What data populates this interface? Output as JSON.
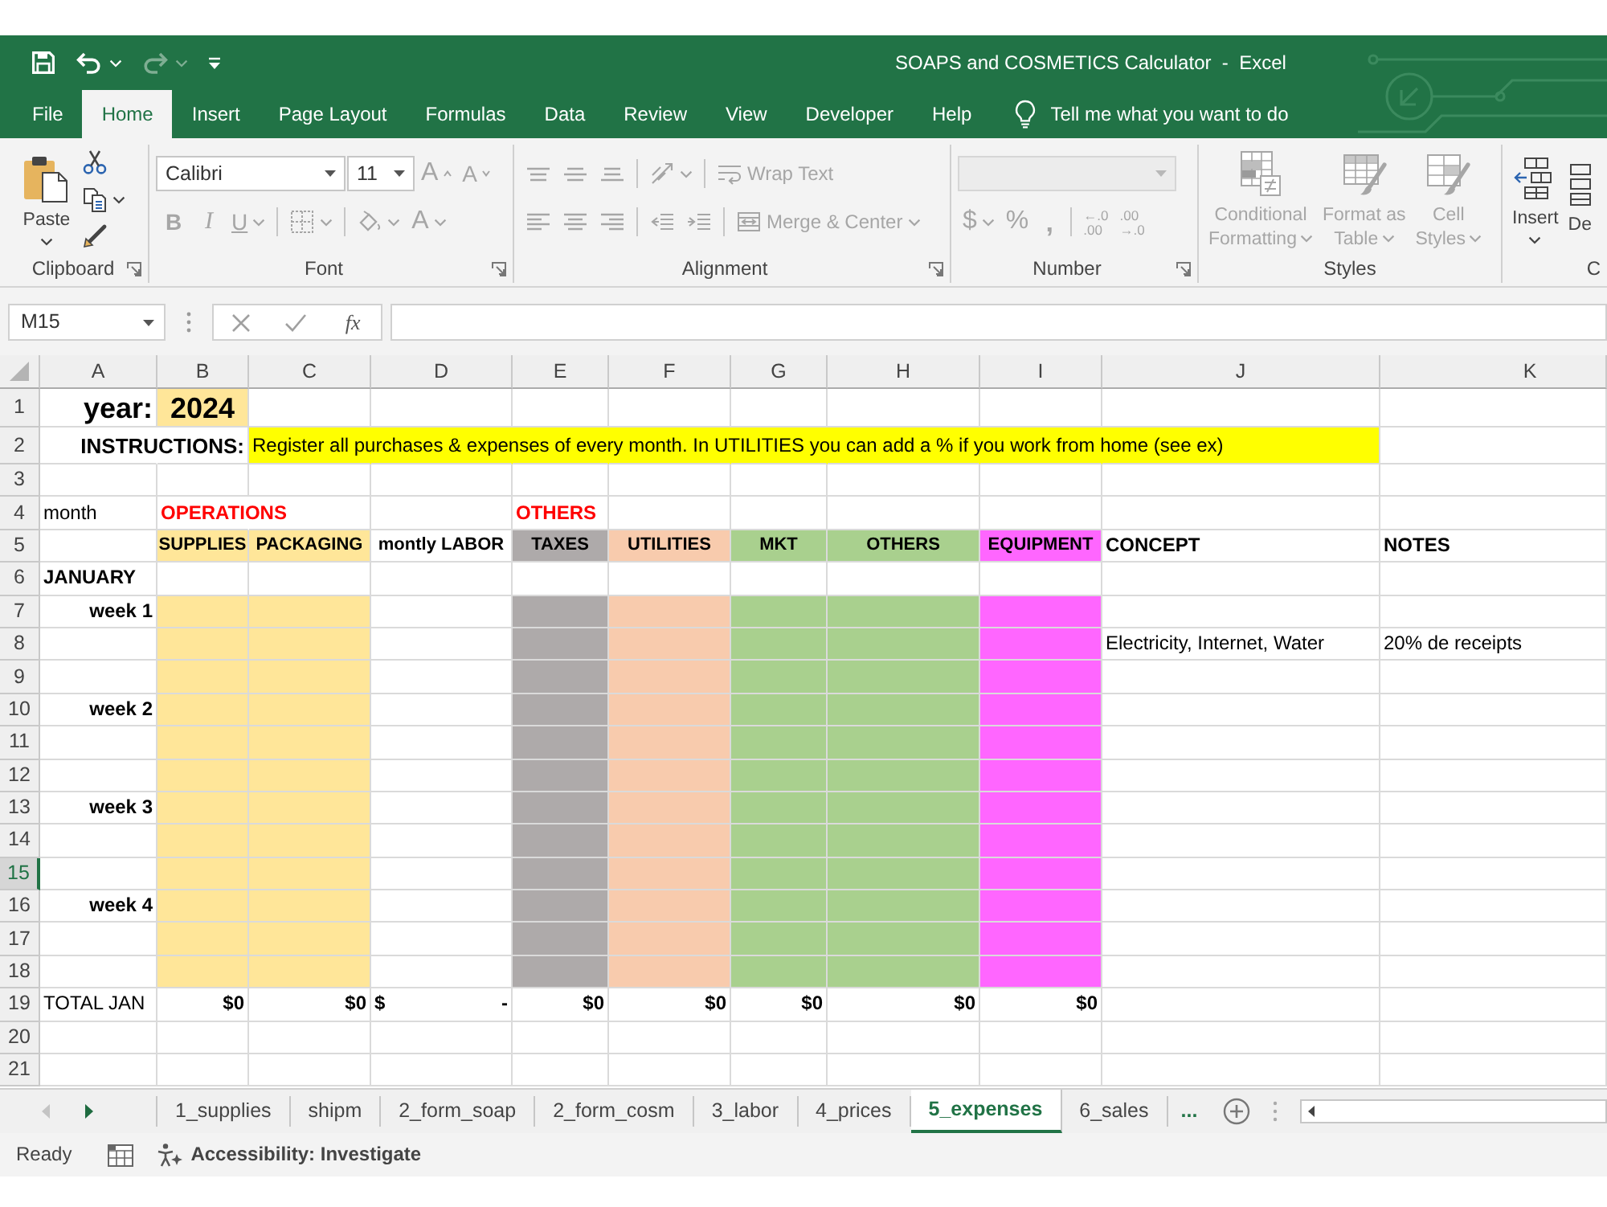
{
  "title_bar": {
    "quick_access": [
      {
        "disabled": false
      },
      {
        "disabled": false
      },
      {
        "disabled": true
      },
      {
        "disabled": false
      }
    ],
    "title": "SOAPS and COSMETICS Calculator  -  Excel"
  },
  "tabs": [
    {
      "label": "File",
      "selected": false
    },
    {
      "label": "Home",
      "selected": true
    },
    {
      "label": "Insert",
      "selected": false
    },
    {
      "label": "Page Layout",
      "selected": false
    },
    {
      "label": "Formulas",
      "selected": false
    },
    {
      "label": "Data",
      "selected": false
    },
    {
      "label": "Review",
      "selected": false
    },
    {
      "label": "View",
      "selected": false
    },
    {
      "label": "Developer",
      "selected": false
    },
    {
      "label": "Help",
      "selected": false
    }
  ],
  "tell_me": {
    "placeholder": "Tell me what you want to do"
  },
  "ribbon": {
    "groups": [
      {
        "label": "Clipboard",
        "launcher": true,
        "items": [
          {
            "kind": "large",
            "lines": [
              "Paste"
            ],
            "disabled": false
          },
          {
            "kind": "icon",
            "disabled": false
          },
          {
            "kind": "icon",
            "disabled": false
          },
          {
            "kind": "icon",
            "disabled": false
          }
        ]
      },
      {
        "label": "Font",
        "launcher": true,
        "items": [
          {
            "kind": "combo",
            "value": "Calibri",
            "disabled": false
          },
          {
            "kind": "combo",
            "value": "11",
            "disabled": false
          },
          {
            "kind": "glyph",
            "label": "A",
            "disabled": true
          },
          {
            "kind": "glyph",
            "label": "A",
            "disabled": true
          },
          {
            "kind": "glyph",
            "label": "B",
            "disabled": true
          },
          {
            "kind": "glyph",
            "label": "I",
            "disabled": true
          },
          {
            "kind": "glyph",
            "label": "U",
            "disabled": true
          },
          {
            "kind": "icon",
            "disabled": true
          },
          {
            "kind": "icon",
            "disabled": true
          },
          {
            "kind": "glyph",
            "label": "A",
            "disabled": true
          }
        ]
      },
      {
        "label": "Alignment",
        "launcher": true,
        "items": [
          {
            "kind": "icon",
            "disabled": true
          },
          {
            "kind": "icon",
            "disabled": true
          },
          {
            "kind": "icon",
            "disabled": true
          },
          {
            "kind": "icon",
            "disabled": true
          },
          {
            "kind": "text",
            "label": "Wrap Text",
            "disabled": true
          },
          {
            "kind": "icon",
            "disabled": true
          },
          {
            "kind": "icon",
            "disabled": true
          },
          {
            "kind": "icon",
            "disabled": true
          },
          {
            "kind": "icon",
            "disabled": true
          },
          {
            "kind": "icon",
            "disabled": true
          },
          {
            "kind": "text",
            "label": "Merge & Center",
            "disabled": true
          }
        ]
      },
      {
        "label": "Number",
        "launcher": true,
        "items": [
          {
            "kind": "combo",
            "disabled": true
          },
          {
            "kind": "glyph",
            "label": "$",
            "disabled": true
          },
          {
            "kind": "glyph",
            "label": "%",
            "disabled": true
          },
          {
            "kind": "glyph",
            "label": ",",
            "disabled": true
          },
          {
            "kind": "stack",
            "lines": [
              "←.0",
              ".00"
            ],
            "disabled": true
          },
          {
            "kind": "stack",
            "lines": [
              ".00",
              "→.0"
            ],
            "disabled": true
          }
        ]
      },
      {
        "label": "Styles",
        "launcher": false,
        "items": [
          {
            "kind": "large",
            "lines": [
              "Conditional",
              "Formatting"
            ],
            "disabled": true
          },
          {
            "kind": "large",
            "lines": [
              "Format as",
              "Table"
            ],
            "disabled": true
          },
          {
            "kind": "large",
            "lines": [
              "Cell",
              "Styles"
            ],
            "disabled": true
          }
        ]
      },
      {
        "label": "C",
        "launcher": false,
        "items": [
          {
            "kind": "large",
            "lines": [
              "Insert"
            ],
            "disabled": false
          },
          {
            "kind": "large",
            "lines": [
              "De"
            ],
            "disabled": false
          }
        ]
      }
    ]
  },
  "formula_bar": {
    "name_box": "M15",
    "function_button": "fx"
  },
  "sheet": {
    "columns": [
      {
        "letter": "A",
        "selected": false
      },
      {
        "letter": "B",
        "selected": false
      },
      {
        "letter": "C",
        "selected": false
      },
      {
        "letter": "D",
        "selected": false
      },
      {
        "letter": "E",
        "selected": false
      },
      {
        "letter": "F",
        "selected": false
      },
      {
        "letter": "G",
        "selected": false
      },
      {
        "letter": "H",
        "selected": false
      },
      {
        "letter": "I",
        "selected": false
      },
      {
        "letter": "J",
        "selected": false
      },
      {
        "letter": "K",
        "selected": false
      }
    ],
    "rows": [
      {
        "number": "1",
        "selected": false,
        "cells": [
          {
            "text": "year:",
            "kind": "prompt"
          },
          {
            "text": "2024",
            "kind": "year",
            "color": "#ffe699"
          }
        ]
      },
      {
        "number": "2",
        "selected": false,
        "cells": [
          null,
          {
            "text": "INSTRUCTIONS:",
            "kind": "caption"
          },
          {
            "text": "Register all purchases & expenses of every month. In UTILITIES you can add a % if you work from home (see ex)",
            "kind": "note",
            "color": "#ffff00"
          },
          {
            "color": "#ffff00"
          },
          {
            "color": "#ffff00"
          },
          {
            "color": "#ffff00"
          },
          {
            "color": "#ffff00"
          },
          {
            "color": "#ffff00"
          },
          {
            "color": "#ffff00"
          },
          {
            "color": "#ffff00"
          }
        ]
      },
      {
        "number": "3",
        "selected": false
      },
      {
        "number": "4",
        "selected": false,
        "cells": [
          {
            "text": "month",
            "kind": "note"
          },
          {
            "text": "OPERATIONS",
            "kind": "group"
          },
          null,
          null,
          {
            "text": "OTHERS",
            "kind": "group"
          }
        ]
      },
      {
        "number": "5",
        "selected": false,
        "cells": [
          null,
          {
            "text": "SUPPLIES",
            "kind": "head",
            "color": "#ffe699"
          },
          {
            "text": "PACKAGING",
            "kind": "head",
            "color": "#ffe699"
          },
          {
            "text": "montly LABOR",
            "kind": "head"
          },
          {
            "text": "TAXES",
            "kind": "head",
            "color": "#aeaaaa"
          },
          {
            "text": "UTILITIES",
            "kind": "head",
            "color": "#f8cbad"
          },
          {
            "text": "MKT",
            "kind": "head",
            "color": "#a9d08e"
          },
          {
            "text": "OTHERS",
            "kind": "head",
            "color": "#a9d08e"
          },
          {
            "text": "EQUIPMENT",
            "kind": "head",
            "color": "#ff66ff"
          },
          {
            "text": "CONCEPT",
            "kind": "title"
          },
          {
            "text": "NOTES",
            "kind": "title"
          }
        ]
      },
      {
        "number": "6",
        "selected": false,
        "cells": [
          {
            "text": "JANUARY",
            "kind": "month"
          }
        ]
      },
      {
        "number": "7",
        "selected": false,
        "cells": [
          {
            "text": "week 1",
            "kind": "label"
          },
          {
            "color": "#ffe699"
          },
          {
            "color": "#ffe699"
          },
          null,
          {
            "color": "#aeaaaa"
          },
          {
            "color": "#f8cbad"
          },
          {
            "color": "#a9d08e"
          },
          {
            "color": "#a9d08e"
          },
          {
            "color": "#ff66ff"
          }
        ]
      },
      {
        "number": "8",
        "selected": false,
        "cells": [
          null,
          {
            "color": "#ffe699"
          },
          {
            "color": "#ffe699"
          },
          null,
          {
            "color": "#aeaaaa"
          },
          {
            "color": "#f8cbad"
          },
          {
            "color": "#a9d08e"
          },
          {
            "color": "#a9d08e"
          },
          {
            "color": "#ff66ff"
          },
          {
            "text": "Electricity, Internet, Water",
            "kind": "note"
          },
          {
            "text": "20% de receipts",
            "kind": "note"
          }
        ]
      },
      {
        "number": "9",
        "selected": false,
        "cells": [
          null,
          {
            "color": "#ffe699"
          },
          {
            "color": "#ffe699"
          },
          null,
          {
            "color": "#aeaaaa"
          },
          {
            "color": "#f8cbad"
          },
          {
            "color": "#a9d08e"
          },
          {
            "color": "#a9d08e"
          },
          {
            "color": "#ff66ff"
          }
        ]
      },
      {
        "number": "10",
        "selected": false,
        "cells": [
          {
            "text": "week 2",
            "kind": "label"
          },
          {
            "color": "#ffe699"
          },
          {
            "color": "#ffe699"
          },
          null,
          {
            "color": "#aeaaaa"
          },
          {
            "color": "#f8cbad"
          },
          {
            "color": "#a9d08e"
          },
          {
            "color": "#a9d08e"
          },
          {
            "color": "#ff66ff"
          }
        ]
      },
      {
        "number": "11",
        "selected": false,
        "cells": [
          null,
          {
            "color": "#ffe699"
          },
          {
            "color": "#ffe699"
          },
          null,
          {
            "color": "#aeaaaa"
          },
          {
            "color": "#f8cbad"
          },
          {
            "color": "#a9d08e"
          },
          {
            "color": "#a9d08e"
          },
          {
            "color": "#ff66ff"
          }
        ]
      },
      {
        "number": "12",
        "selected": false,
        "cells": [
          null,
          {
            "color": "#ffe699"
          },
          {
            "color": "#ffe699"
          },
          null,
          {
            "color": "#aeaaaa"
          },
          {
            "color": "#f8cbad"
          },
          {
            "color": "#a9d08e"
          },
          {
            "color": "#a9d08e"
          },
          {
            "color": "#ff66ff"
          }
        ]
      },
      {
        "number": "13",
        "selected": false,
        "cells": [
          {
            "text": "week 3",
            "kind": "label"
          },
          {
            "color": "#ffe699"
          },
          {
            "color": "#ffe699"
          },
          null,
          {
            "color": "#aeaaaa"
          },
          {
            "color": "#f8cbad"
          },
          {
            "color": "#a9d08e"
          },
          {
            "color": "#a9d08e"
          },
          {
            "color": "#ff66ff"
          }
        ]
      },
      {
        "number": "14",
        "selected": false,
        "cells": [
          null,
          {
            "color": "#ffe699"
          },
          {
            "color": "#ffe699"
          },
          null,
          {
            "color": "#aeaaaa"
          },
          {
            "color": "#f8cbad"
          },
          {
            "color": "#a9d08e"
          },
          {
            "color": "#a9d08e"
          },
          {
            "color": "#ff66ff"
          }
        ]
      },
      {
        "number": "15",
        "selected": true,
        "cells": [
          null,
          {
            "color": "#ffe699"
          },
          {
            "color": "#ffe699"
          },
          null,
          {
            "color": "#aeaaaa"
          },
          {
            "color": "#f8cbad"
          },
          {
            "color": "#a9d08e"
          },
          {
            "color": "#a9d08e"
          },
          {
            "color": "#ff66ff"
          }
        ]
      },
      {
        "number": "16",
        "selected": false,
        "cells": [
          {
            "text": "week 4",
            "kind": "label"
          },
          {
            "color": "#ffe699"
          },
          {
            "color": "#ffe699"
          },
          null,
          {
            "color": "#aeaaaa"
          },
          {
            "color": "#f8cbad"
          },
          {
            "color": "#a9d08e"
          },
          {
            "color": "#a9d08e"
          },
          {
            "color": "#ff66ff"
          }
        ]
      },
      {
        "number": "17",
        "selected": false,
        "cells": [
          null,
          {
            "color": "#ffe699"
          },
          {
            "color": "#ffe699"
          },
          null,
          {
            "color": "#aeaaaa"
          },
          {
            "color": "#f8cbad"
          },
          {
            "color": "#a9d08e"
          },
          {
            "color": "#a9d08e"
          },
          {
            "color": "#ff66ff"
          }
        ]
      },
      {
        "number": "18",
        "selected": false,
        "cells": [
          null,
          {
            "color": "#ffe699"
          },
          {
            "color": "#ffe699"
          },
          null,
          {
            "color": "#aeaaaa"
          },
          {
            "color": "#f8cbad"
          },
          {
            "color": "#a9d08e"
          },
          {
            "color": "#a9d08e"
          },
          {
            "color": "#ff66ff"
          }
        ]
      },
      {
        "number": "19",
        "selected": false,
        "cells": [
          {
            "text": "TOTAL JAN",
            "kind": "note"
          },
          {
            "text": "$0",
            "kind": "total"
          },
          {
            "text": "$0",
            "kind": "total"
          },
          {
            "symbol": "$",
            "text": "-",
            "kind": "accounting"
          },
          {
            "text": "$0",
            "kind": "total"
          },
          {
            "text": "$0",
            "kind": "total"
          },
          {
            "text": "$0",
            "kind": "total"
          },
          {
            "text": "$0",
            "kind": "total"
          },
          {
            "text": "$0",
            "kind": "total"
          }
        ]
      },
      {
        "number": "20",
        "selected": false
      },
      {
        "number": "21",
        "selected": false
      }
    ]
  },
  "sheet_tabs": {
    "nav": [
      {
        "disabled": true
      },
      {
        "disabled": false
      }
    ],
    "tabs": [
      {
        "label": "1_supplies",
        "selected": false
      },
      {
        "label": "shipm",
        "selected": false
      },
      {
        "label": "2_form_soap",
        "selected": false
      },
      {
        "label": "2_form_cosm",
        "selected": false
      },
      {
        "label": "3_labor",
        "selected": false
      },
      {
        "label": "4_prices",
        "selected": false
      },
      {
        "label": "5_expenses",
        "selected": true
      },
      {
        "label": "6_sales",
        "selected": false
      }
    ],
    "more": "..."
  },
  "status_bar": {
    "mode": "Ready",
    "accessibility": "Accessibility: Investigate"
  }
}
